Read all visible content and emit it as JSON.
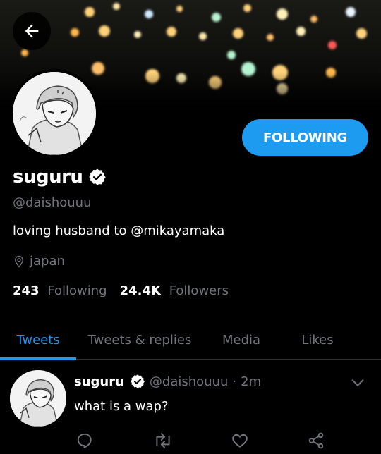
{
  "profile": {
    "display_name": "suguru",
    "handle": "@daishouuu",
    "bio": "loving husband to @mikayamaka",
    "location": "japan",
    "follow_button": "FOLLOWING",
    "following_count": "243",
    "following_label": "Following",
    "followers_count": "24.4K",
    "followers_label": "Followers"
  },
  "tabs": [
    {
      "label": "Tweets",
      "active": true
    },
    {
      "label": "Tweets & replies",
      "active": false
    },
    {
      "label": "Media",
      "active": false
    },
    {
      "label": "Likes",
      "active": false
    }
  ],
  "tweet": {
    "name": "suguru",
    "handle": "@daishouuu",
    "separator": "·",
    "time": "2m",
    "text": "what is a wap?"
  },
  "colors": {
    "accent": "#1d9bf0",
    "muted": "#71767b",
    "background": "#000000"
  }
}
